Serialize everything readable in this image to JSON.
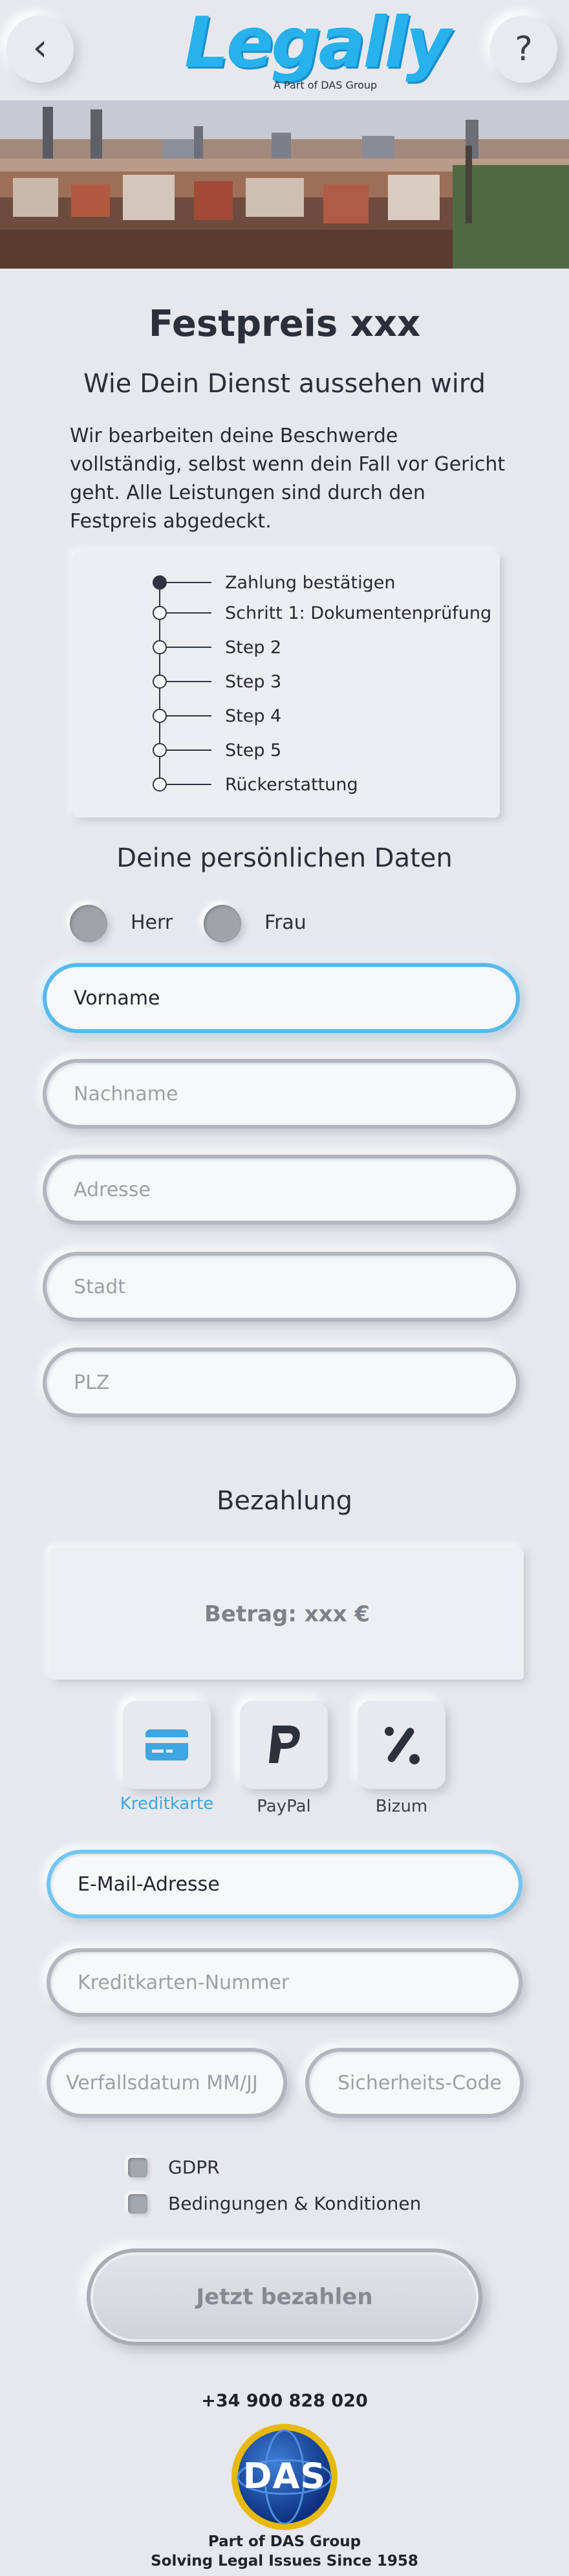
{
  "header": {
    "back_icon": "chevron-left-icon",
    "help_icon": "question-icon",
    "back_glyph": "‹",
    "help_glyph": "?",
    "logo_text": "Legally",
    "logo_subtitle": "A Part of DAS Group",
    "brand_color": "#27b2ec"
  },
  "product": {
    "title": "Festpreis xxx",
    "subtitle": "Wie Dein Dienst aussehen wird",
    "description": "Wir bearbeiten deine Beschwerde vollständig, selbst wenn dein Fall vor Gericht geht. Alle Leistungen sind durch den Festpreis abgedeckt."
  },
  "steps": [
    {
      "label": "Zahlung bestätigen",
      "done": true
    },
    {
      "label": "Schritt 1: Dokumentenprüfung",
      "done": false
    },
    {
      "label": "Step 2",
      "done": false
    },
    {
      "label": "Step 3",
      "done": false
    },
    {
      "label": "Step 4",
      "done": false
    },
    {
      "label": "Step 5",
      "done": false
    },
    {
      "label": "Rückerstattung",
      "done": false
    }
  ],
  "personal": {
    "heading": "Deine persönlichen Daten",
    "salutation": {
      "herr": "Herr",
      "frau": "Frau"
    },
    "fields": {
      "first_name": "Vorname",
      "last_name": "Nachname",
      "address": "Adresse",
      "city": "Stadt",
      "zip": "PLZ"
    }
  },
  "payment": {
    "heading": "Bezahlung",
    "amount": "Betrag: xxx €",
    "methods": [
      {
        "label": "Kreditkarte",
        "icon": "credit-card-icon",
        "selected": true
      },
      {
        "label": "PayPal",
        "icon": "paypal-icon",
        "selected": false
      },
      {
        "label": "Bizum",
        "icon": "bizum-icon",
        "selected": false
      }
    ],
    "fields": {
      "email": "E-Mail-Adresse",
      "card_number": "Kreditkarten-Nummer",
      "expiry": "Verfallsdatum MM/JJ",
      "cvc": "Sicherheits-Code"
    },
    "checks": {
      "gdpr": "GDPR",
      "terms": "Bedingungen & Konditionen"
    },
    "submit": "Jetzt bezahlen",
    "accent_color": "#3ea6e0"
  },
  "footer": {
    "phone": "+34 900 828 020",
    "das_logo_text": "DAS",
    "line1": "Part of DAS Group",
    "line2": "Solving Legal Issues Since 1958"
  }
}
